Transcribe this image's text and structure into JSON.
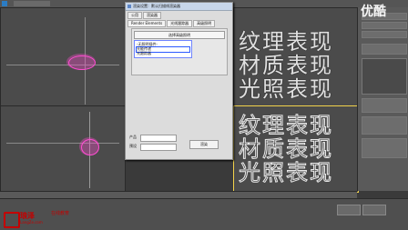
{
  "watermark": {
    "youku": "优酷"
  },
  "overlay_text": {
    "line1": "纹理表现",
    "line2": "材质表现",
    "line3": "光照表现"
  },
  "dialog": {
    "title": "渲染设置：默认扫描线渲染器",
    "tabs_top": [
      "公用",
      "渲染器"
    ],
    "tabs_row2": [
      "Render Elements",
      "光线跟踪器",
      "高级照明"
    ],
    "group_button": "选择高级照明",
    "list_items": [
      "-无照明插件-",
      "光能传递",
      "光跟踪器"
    ],
    "bottom_labels": [
      "产品",
      "预设"
    ],
    "bottom_button": "渲染"
  },
  "brand": {
    "name": "琅泽",
    "sub": "在线教育",
    "url": "LangZe.com"
  }
}
